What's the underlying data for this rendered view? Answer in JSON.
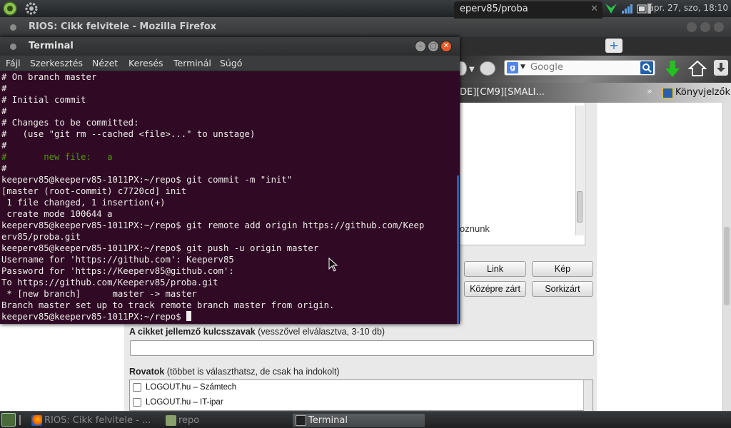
{
  "top_panel": {
    "clock": "ápr. 27, szo, 18:10"
  },
  "firefox": {
    "window_title": "RIOS: Cikk felvitele - Mozilla Firefox",
    "tab_label": "eperv85/proba",
    "new_tab_symbol": "+",
    "search_engine_letter": "g",
    "search_placeholder": "Google",
    "bookmark_item": "DE][CM9][SMALI...",
    "bookmarks_chevron": "»",
    "bookmarks_label": "Könyvjelzők"
  },
  "page": {
    "snippet_text": "oznunk",
    "buttons": {
      "link": "Link",
      "image": "Kép",
      "center": "Középre zárt",
      "justify": "Sorkizárt"
    },
    "keywords_label_bold": "A cikket jellemző kulcsszavak",
    "keywords_label_rest": " (vesszővel elválasztva, 3-10 db)",
    "categories_label_bold": "Rovatok",
    "categories_label_rest": " (többet is választhatsz, de csak ha indokolt)",
    "categories": [
      "LOGOUT.hu – Számtech",
      "LOGOUT.hu – IT-ipar"
    ]
  },
  "terminal": {
    "title": "Terminal",
    "menu": [
      "Fájl",
      "Szerkesztés",
      "Nézet",
      "Keresés",
      "Terminál",
      "Súgó"
    ],
    "lines": [
      "# On branch master",
      "#",
      "# Initial commit",
      "#",
      "# Changes to be committed:",
      "#   (use \"git rm --cached <file>...\" to unstage)",
      "#",
      "#\tnew file:   a",
      "#",
      "keeperv85@keeperv85-1011PX:~/repo$ git commit -m \"init\"",
      "[master (root-commit) c7720cd] init",
      " 1 file changed, 1 insertion(+)",
      " create mode 100644 a",
      "keeperv85@keeperv85-1011PX:~/repo$ git remote add origin https://github.com/Keep",
      "erv85/proba.git",
      "keeperv85@keeperv85-1011PX:~/repo$ git push -u origin master",
      "Username for 'https://github.com': Keeperv85",
      "Password for 'https://Keeperv85@github.com':",
      "To https://github.com/Keeperv85/proba.git",
      " * [new branch]      master -> master",
      "Branch master set up to track remote branch master from origin.",
      "keeperv85@keeperv85-1011PX:~/repo$ "
    ],
    "green_line_index": 7
  },
  "taskbar": {
    "tasks": [
      "RIOS: Cikk felvitele - ...",
      "repo",
      "Terminal"
    ]
  },
  "colors": {
    "terminal_bg": "#300a24",
    "terminal_text": "#eeeeec",
    "terminal_green": "#4e9a06"
  }
}
